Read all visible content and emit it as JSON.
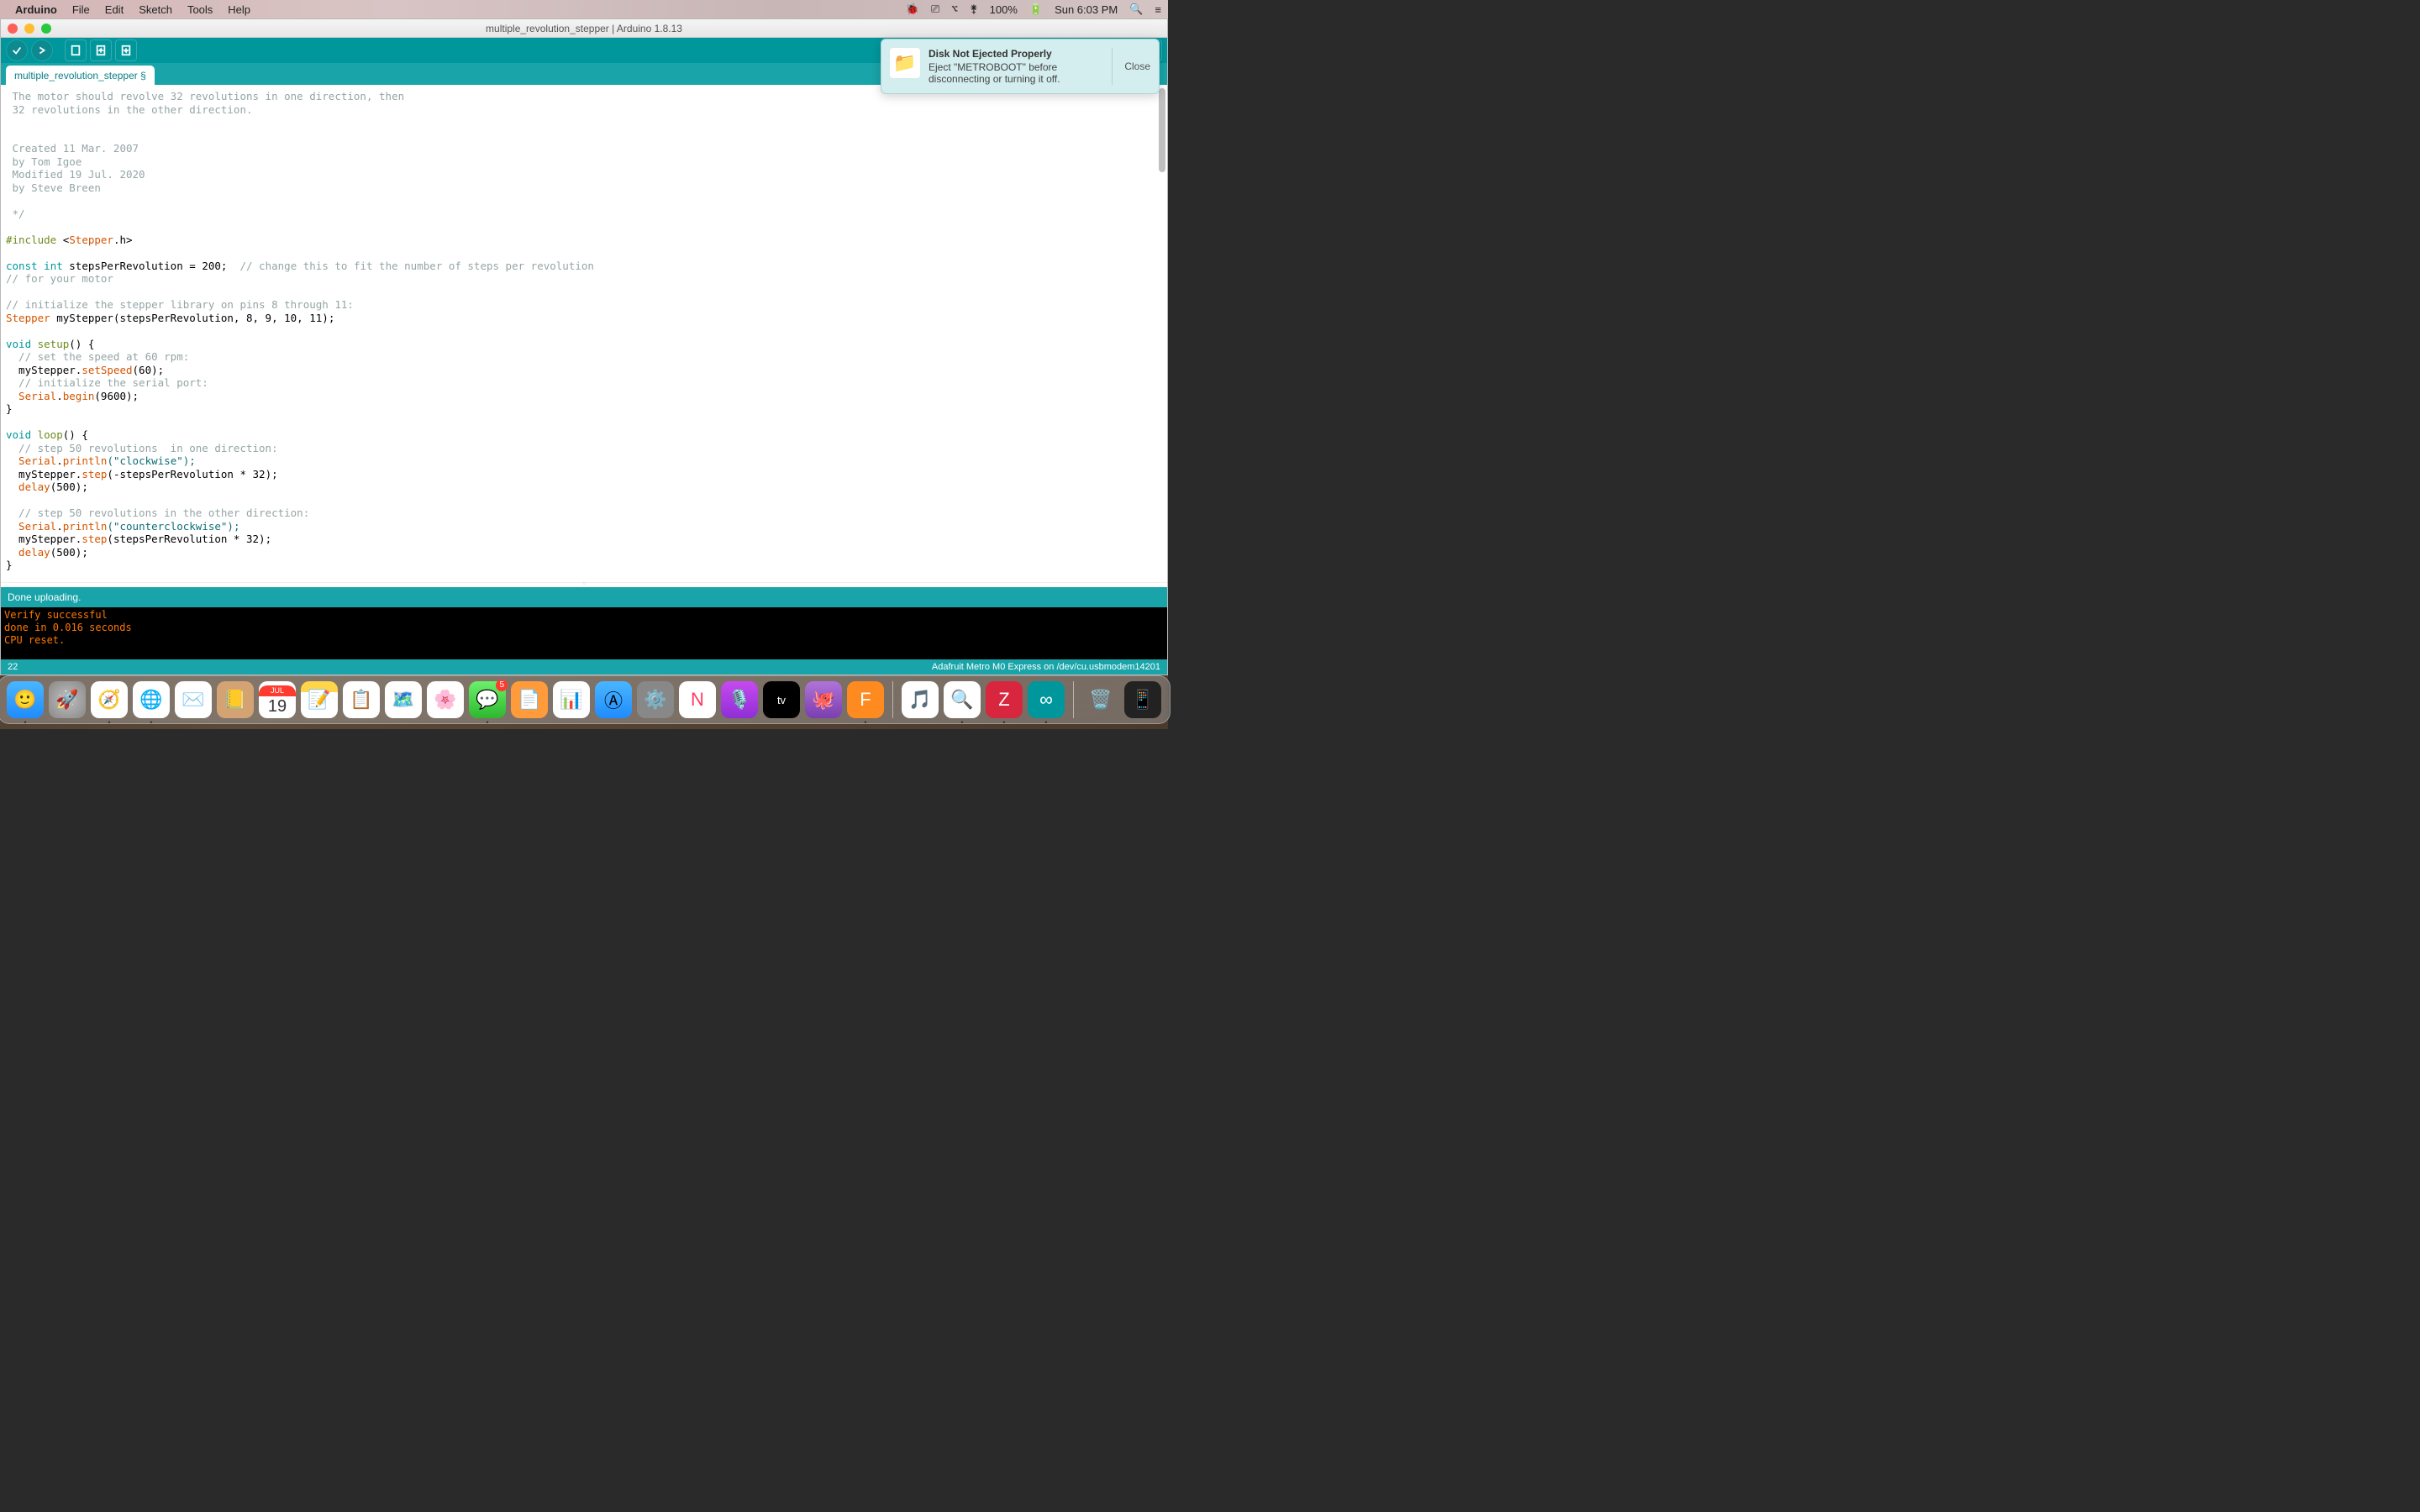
{
  "menubar": {
    "app": "Arduino",
    "items": [
      "File",
      "Edit",
      "Sketch",
      "Tools",
      "Help"
    ],
    "battery": "100%",
    "datetime": "Sun 6:03 PM"
  },
  "window": {
    "title": "multiple_revolution_stepper | Arduino 1.8.13",
    "tab": "multiple_revolution_stepper §"
  },
  "code": {
    "comment1": " The motor should revolve 32 revolutions in one direction, then",
    "comment2": " 32 revolutions in the other direction.",
    "comment3": " Created 11 Mar. 2007",
    "comment4": " by Tom Igoe",
    "comment5": " Modified 19 Jul. 2020",
    "comment6": " by Steve Breen",
    "comment7": " */",
    "include_kw": "#include",
    "include_open": " <",
    "include_lib": "Stepper",
    "include_close": ".h>",
    "const": "const",
    "int": "int",
    "var1": " stepsPerRevolution",
    "eq200": " = 200;  ",
    "varcmt": "// change this to fit the number of steps per revolution",
    "varcmt2": "// for your motor",
    "initcmt": "// initialize the stepper library on pins 8 through 11:",
    "stepper": "Stepper",
    "stepperinit": " myStepper(stepsPerRevolution, 8, 9, 10, 11);",
    "void1": "void",
    "setup": " setup",
    "setupbrace": "() {",
    "setupc1": "  // set the speed at 60 rpm:",
    "mystep": "  myStepper.",
    "setspeed": "setSpeed",
    "setspeed60": "(60);",
    "setupc2": "  // initialize the serial port:",
    "serial": "  Serial",
    "dot": ".",
    "begin": "begin",
    "begin9600": "(9600);",
    "closebrace": "}",
    "loop": " loop",
    "loopc1": "  // step 50 revolutions  in one direction:",
    "println": "println",
    "printcw": "(\"clockwise\");",
    "step": "step",
    "stepneg": "(-stepsPerRevolution * 32);",
    "delay": "  delay",
    "delay500": "(500);",
    "loopc2": "  // step 50 revolutions in the other direction:",
    "printccw": "(\"counterclockwise\");",
    "steppos": "(stepsPerRevolution * 32);"
  },
  "status": "Done uploading.",
  "console": {
    "l1": "Verify successful",
    "l2": "done in 0.016 seconds",
    "l3": "CPU reset."
  },
  "footer": {
    "left": "22",
    "right": "Adafruit Metro M0 Express on /dev/cu.usbmodem14201"
  },
  "notification": {
    "title": "Disk Not Ejected Properly",
    "body": "Eject \"METROBOOT\" before disconnecting or turning it off.",
    "close": "Close"
  },
  "dock": {
    "cal_month": "JUL",
    "cal_day": "19",
    "mail_badge": "5"
  }
}
